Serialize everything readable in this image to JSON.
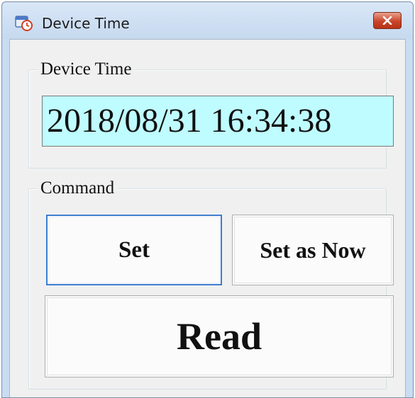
{
  "window": {
    "title": "Device Time",
    "icon": "clock-calendar-icon",
    "close_icon": "close-icon"
  },
  "device_time_group": {
    "legend": "Device Time",
    "value": "2018/08/31 16:34:38",
    "field_color": "#bffcff"
  },
  "command_group": {
    "legend": "Command",
    "set_label": "Set",
    "set_as_now_label": "Set as Now",
    "read_label": "Read",
    "focused_button": "Set",
    "focus_color": "#3d7ed0"
  }
}
